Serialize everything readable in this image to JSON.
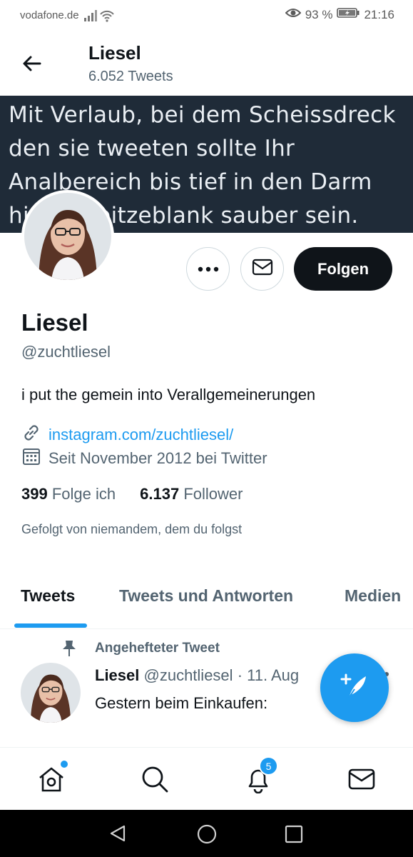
{
  "status_bar": {
    "carrier": "vodafone.de",
    "battery": "93 %",
    "time": "21:16"
  },
  "header": {
    "name": "Liesel",
    "tweet_count": "6.052 Tweets"
  },
  "banner": {
    "text": "Mit Verlaub, bei dem Scheissdreck den sie tweeten sollte Ihr Analbereich bis tief in den Darm hinein spitzeblank sauber sein."
  },
  "actions": {
    "follow_label": "Folgen"
  },
  "profile": {
    "name": "Liesel",
    "handle": "@zuchtliesel",
    "bio": "i put the gemein into Verallgemeinerungen",
    "link": "instagram.com/zuchtliesel/",
    "joined": "Seit November 2012 bei Twitter",
    "following_count": "399",
    "following_label": "Folge ich",
    "followers_count": "6.137",
    "followers_label": "Follower",
    "followed_by": "Gefolgt von niemandem, dem du folgst"
  },
  "tabs": [
    {
      "label": "Tweets",
      "active": true
    },
    {
      "label": "Tweets und Antworten",
      "active": false
    },
    {
      "label": "Medien",
      "active": false
    }
  ],
  "tweet": {
    "pinned_label": "Angehefteter Tweet",
    "author": "Liesel",
    "handle": "@zuchtliesel",
    "date": "· 11. Aug",
    "text": "Gestern beim Einkaufen:"
  },
  "bottom_nav": {
    "notification_badge": "5",
    "icons": [
      "home-icon",
      "search-icon",
      "bell-icon",
      "mail-icon"
    ]
  },
  "colors": {
    "accent": "#1d9bf0",
    "banner_bg": "#1f2b38",
    "text_primary": "#0f1419",
    "text_secondary": "#536471"
  }
}
